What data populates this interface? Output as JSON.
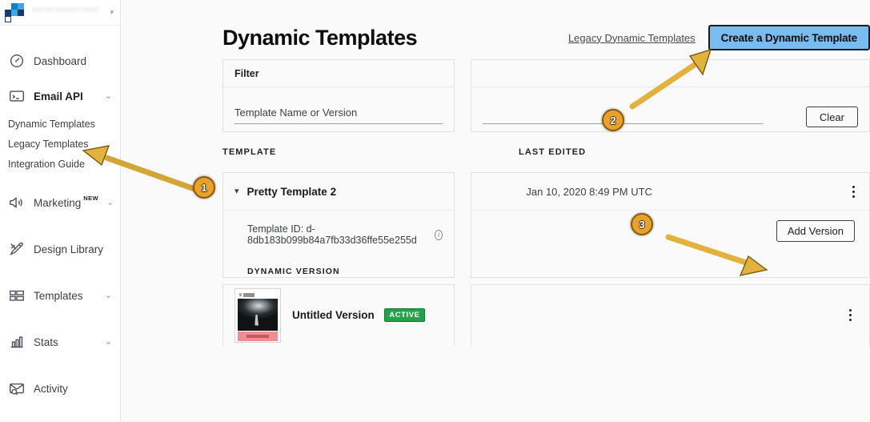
{
  "sidebar": {
    "account_name": "blurred account name",
    "logo_icon": "sendgrid-logo-icon",
    "caret_icon": "chevron-down-icon",
    "items": [
      {
        "label": "Dashboard",
        "icon": "speedometer-icon",
        "caret": ""
      },
      {
        "label": "Email API",
        "icon": "terminal-icon",
        "caret": "⌄"
      },
      {
        "label": "Marketing",
        "icon": "megaphone-icon",
        "caret": "⌄",
        "tag": "NEW"
      },
      {
        "label": "Design Library",
        "icon": "pencil-ruler-icon",
        "caret": ""
      },
      {
        "label": "Templates",
        "icon": "layout-rows-icon",
        "caret": "⌄"
      },
      {
        "label": "Stats",
        "icon": "bar-chart-icon",
        "caret": "⌄"
      },
      {
        "label": "Activity",
        "icon": "envelope-search-icon",
        "caret": ""
      }
    ],
    "sub_items": [
      {
        "label": "Dynamic Templates"
      },
      {
        "label": "Legacy Templates"
      },
      {
        "label": "Integration Guide"
      }
    ]
  },
  "header": {
    "title": "Dynamic Templates",
    "legacy_link": "Legacy Dynamic Templates",
    "create_button": "Create a Dynamic Template"
  },
  "filter": {
    "heading": "Filter",
    "name_placeholder": "Template Name or Version",
    "name_value": "",
    "right_value": "",
    "clear_button": "Clear"
  },
  "table": {
    "col_template": "TEMPLATE",
    "col_last_edited": "LAST EDITED",
    "template": {
      "name": "Pretty Template 2",
      "chevron_icon": "chevron-down-icon",
      "last_edited": "Jan 10, 2020 8:49 PM UTC",
      "kebab_icon": "more-vertical-icon",
      "template_id_label": "Template ID: d-8db183b099b84a7fb33d36ffe55e255d",
      "info_icon": "info-icon",
      "info_glyph": "i",
      "dynamic_version_label": "DYNAMIC VERSION",
      "add_version_button": "Add Version",
      "version": {
        "name": "Untitled Version",
        "status": "ACTIVE",
        "thumbnail_icon": "email-template-thumbnail",
        "kebab_icon": "more-vertical-icon"
      }
    }
  },
  "annotations": {
    "colors": {
      "badge_fill": "#E8A12B",
      "badge_stroke": "#8a5a06",
      "arrow": "#E3B23C",
      "accent_button": "#79bcf0",
      "active_badge": "#21a34a"
    },
    "steps": [
      {
        "number": "1",
        "target": "Dynamic Templates sidebar link"
      },
      {
        "number": "2",
        "target": "Create a Dynamic Template button"
      },
      {
        "number": "3",
        "target": "Add Version button"
      }
    ]
  }
}
